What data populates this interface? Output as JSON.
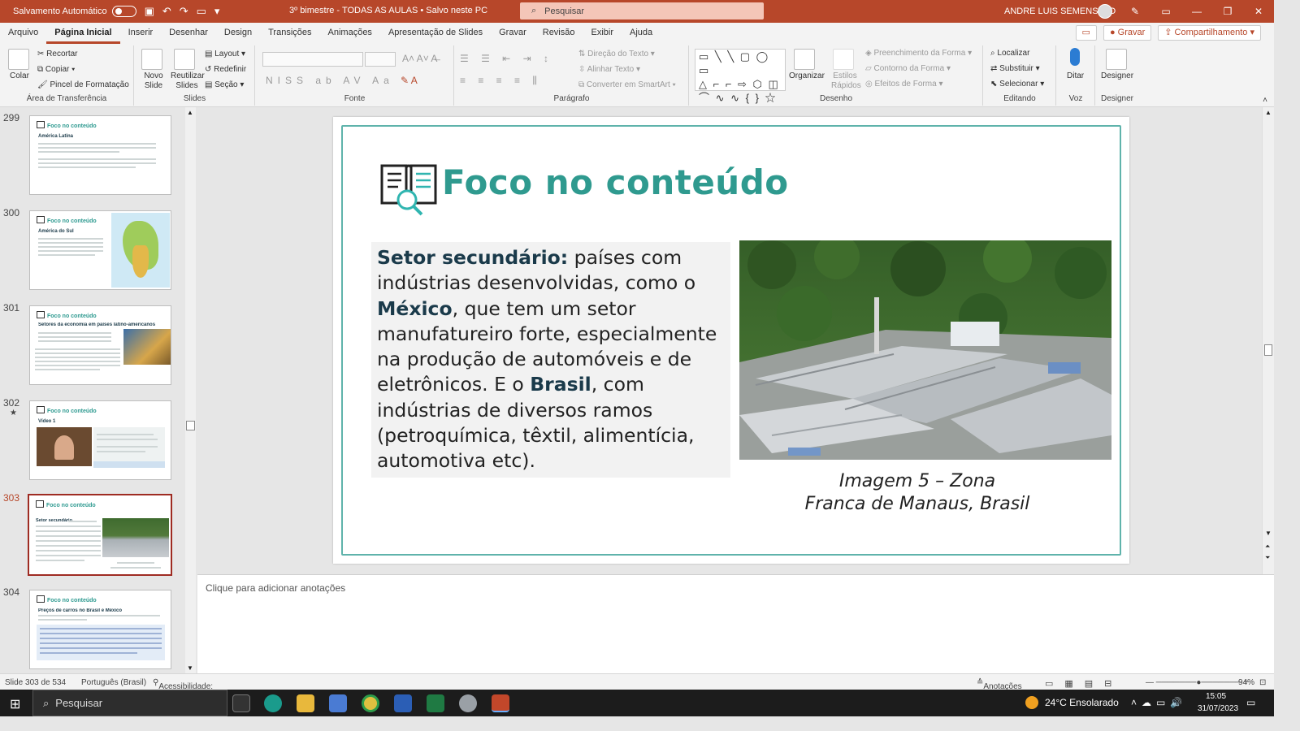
{
  "titlebar": {
    "autosave_label": "Salvamento Automático",
    "doc_title": "3º bimestre - TODAS AS AULAS  •  Salvo neste PC",
    "search_placeholder": "Pesquisar",
    "user_name": "ANDRE LUIS SEMENSATO"
  },
  "tabs": [
    "Arquivo",
    "Página Inicial",
    "Inserir",
    "Desenhar",
    "Design",
    "Transições",
    "Animações",
    "Apresentação de Slides",
    "Gravar",
    "Revisão",
    "Exibir",
    "Ajuda"
  ],
  "tab_actions": {
    "gravar": "Gravar",
    "share": "Compartilhamento"
  },
  "ribbon": {
    "clipboard": {
      "label": "Área de Transferência",
      "paste": "Colar",
      "cut": "Recortar",
      "copy": "Copiar",
      "format_painter": "Pincel de Formatação"
    },
    "slides": {
      "label": "Slides",
      "new_slide": "Novo Slide",
      "reuse": "Reutilizar Slides",
      "layout": "Layout",
      "reset": "Redefinir",
      "section": "Seção"
    },
    "font": {
      "label": "Fonte"
    },
    "paragraph": {
      "label": "Parágrafo",
      "text_direction": "Direção do Texto",
      "align_text": "Alinhar Texto",
      "smartart": "Converter em SmartArt"
    },
    "drawing": {
      "label": "Desenho",
      "arrange": "Organizar",
      "quick_styles": "Estilos Rápidos",
      "shape_fill": "Preenchimento da Forma",
      "shape_outline": "Contorno da Forma",
      "shape_effects": "Efeitos de Forma"
    },
    "editing": {
      "label": "Editando",
      "find": "Localizar",
      "replace": "Substituir",
      "select": "Selecionar"
    },
    "voice": {
      "label": "Voz",
      "dictate": "Ditar"
    },
    "designer": {
      "label": "Designer",
      "designer": "Designer"
    }
  },
  "thumbnails": [
    {
      "num": "299",
      "title": "Foco no conteúdo",
      "heading": "América Latina"
    },
    {
      "num": "300",
      "title": "Foco no conteúdo",
      "heading": "América do Sul"
    },
    {
      "num": "301",
      "title": "Foco no conteúdo",
      "heading": "Setores da economia em países latino-americanos"
    },
    {
      "num": "302",
      "title": "Foco no conteúdo",
      "heading": "Vídeo 1"
    },
    {
      "num": "303",
      "title": "Foco no conteúdo",
      "heading": "Setor secundário"
    },
    {
      "num": "304",
      "title": "Foco no conteúdo",
      "heading": "Preços de carros no Brasil e México"
    }
  ],
  "slide": {
    "title": "Foco no conteúdo",
    "body": {
      "p1_bold": "Setor secundário:",
      "p1": " países com indústrias desenvolvidas, como o ",
      "p2_bold": "México",
      "p2": ", que tem um setor manufatureiro forte, especialmente na produção de automóveis e de eletrônicos. E o ",
      "p3_bold": "Brasil",
      "p3": ", com indústrias de diversos ramos (petroquímica, têxtil, alimentícia, automotiva etc)."
    },
    "caption_line1": "Imagem 5 – Zona",
    "caption_line2": "Franca de Manaus, Brasil"
  },
  "notes_placeholder": "Clique para adicionar anotações",
  "status": {
    "slide_count": "Slide 303 de 534",
    "language": "Português (Brasil)",
    "accessibility": "Acessibilidade: investigar",
    "notes": "Anotações",
    "zoom": "94%"
  },
  "taskbar": {
    "search": "Pesquisar",
    "weather": "24°C  Ensolarado",
    "time": "15:05",
    "date": "31/07/2023"
  },
  "colors": {
    "accent": "#b7472a",
    "teal": "#2f9a8f"
  }
}
